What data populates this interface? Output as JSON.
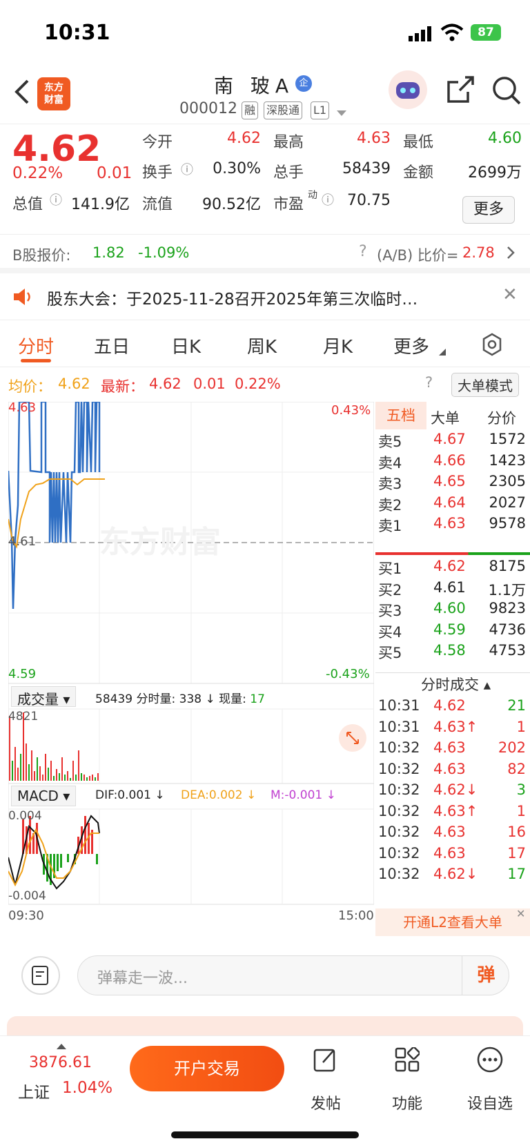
{
  "status": {
    "time": "10:31",
    "battery": "87"
  },
  "header": {
    "logo_line1": "东方",
    "logo_line2": "财富",
    "name": "南 玻A",
    "qi_badge": "企",
    "code": "000012",
    "tags": [
      "融",
      "深股通",
      "L1"
    ]
  },
  "quote": {
    "price": "4.62",
    "pct": "0.22%",
    "chg": "0.01",
    "open_label": "今开",
    "open": "4.62",
    "high_label": "最高",
    "high": "4.63",
    "low_label": "最低",
    "low": "4.60",
    "turnover_label": "换手",
    "turnover": "0.30%",
    "vol_label": "总手",
    "vol": "58439",
    "amount_label": "金额",
    "amount": "2699万",
    "mcap_label": "总值",
    "mcap": "141.9亿",
    "float_label": "流值",
    "float": "90.52亿",
    "pe_label": "市盈",
    "pe_sup": "动",
    "pe": "70.75",
    "more": "更多"
  },
  "bshare": {
    "label": "B股报价:",
    "price": "1.82",
    "pct": "-1.09%",
    "ratio_label": "(A/B) 比价=",
    "ratio": "2.78"
  },
  "notice": {
    "text": "股东大会：于2025-11-28召开2025年第三次临时…"
  },
  "tabs": [
    "分时",
    "五日",
    "日K",
    "周K",
    "月K",
    "更多"
  ],
  "avg": {
    "avg_label": "均价：",
    "avg": "4.62",
    "latest_label": "最新：",
    "latest": "4.62",
    "chg": "0.01",
    "pct": "0.22%",
    "mode": "大单模式"
  },
  "chart": {
    "y_top": "4.63",
    "y_mid": "4.61",
    "y_bot": "4.59",
    "pct_top": "0.43%",
    "pct_bot": "-0.43%",
    "watermark": "东方财富",
    "vol_selector": "成交量",
    "vol_total": "58439",
    "vol_minute_label": "分时量:",
    "vol_minute": "338",
    "vol_now_label": "现量:",
    "vol_now": "17",
    "vol_max": "4821",
    "macd_selector": "MACD",
    "dif": "DIF:0.001",
    "dea": "DEA:0.002",
    "m": "M:-0.001",
    "macd_top": "0.004",
    "macd_bot": "-0.004",
    "x_start": "09:30",
    "x_end": "15:00"
  },
  "book": {
    "tabs": [
      "五档",
      "大单",
      "分价"
    ],
    "asks": [
      {
        "label": "卖5",
        "price": "4.67",
        "vol": "1572"
      },
      {
        "label": "卖4",
        "price": "4.66",
        "vol": "1423"
      },
      {
        "label": "卖3",
        "price": "4.65",
        "vol": "2305"
      },
      {
        "label": "卖2",
        "price": "4.64",
        "vol": "2027"
      },
      {
        "label": "卖1",
        "price": "4.63",
        "vol": "9578"
      }
    ],
    "bids": [
      {
        "label": "买1",
        "price": "4.62",
        "vol": "8175"
      },
      {
        "label": "买2",
        "price": "4.61",
        "vol": "1.1万"
      },
      {
        "label": "买3",
        "price": "4.60",
        "vol": "9823"
      },
      {
        "label": "买4",
        "price": "4.59",
        "vol": "4736"
      },
      {
        "label": "买5",
        "price": "4.58",
        "vol": "4753"
      }
    ],
    "trades_title": "分时成交",
    "trades": [
      {
        "time": "10:31",
        "price": "4.62",
        "vol": "21"
      },
      {
        "time": "10:31",
        "price": "4.63↑",
        "vol": "1"
      },
      {
        "time": "10:32",
        "price": "4.63",
        "vol": "202"
      },
      {
        "time": "10:32",
        "price": "4.63",
        "vol": "82"
      },
      {
        "time": "10:32",
        "price": "4.62↓",
        "vol": "3"
      },
      {
        "time": "10:32",
        "price": "4.63↑",
        "vol": "1"
      },
      {
        "time": "10:32",
        "price": "4.63",
        "vol": "16"
      },
      {
        "time": "10:32",
        "price": "4.63",
        "vol": "17"
      },
      {
        "time": "10:32",
        "price": "4.62↓",
        "vol": "17"
      }
    ],
    "l2_cta": "开通L2查看大单"
  },
  "comment": {
    "placeholder": "弹幕走一波...",
    "btn": "弹"
  },
  "bottom": {
    "index_value": "3876.61",
    "index_name": "上证",
    "index_pct": "1.04%",
    "open_account": "开户交易",
    "nav": [
      "发帖",
      "功能",
      "设自选"
    ]
  }
}
